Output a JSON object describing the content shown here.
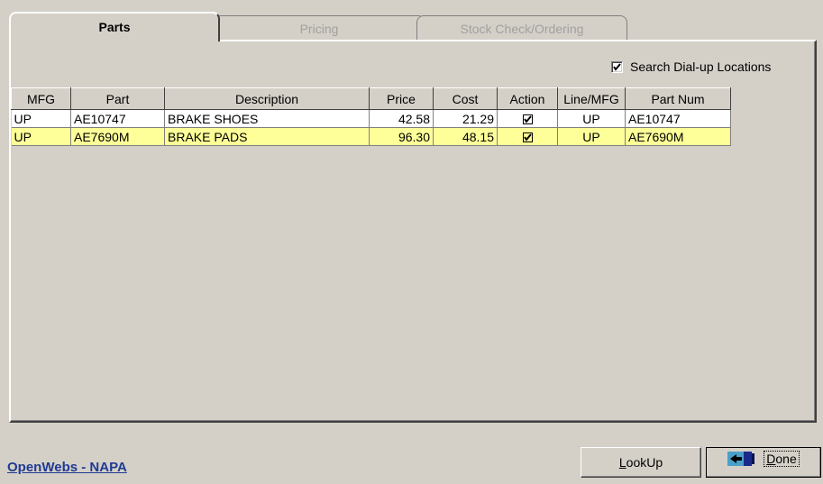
{
  "tabs": {
    "parts": "Parts",
    "pricing": "Pricing",
    "stock": "Stock Check/Ordering"
  },
  "options": {
    "search_dialup_label": "Search Dial-up Locations",
    "search_dialup_checked": true
  },
  "grid": {
    "columns": [
      "MFG",
      "Part",
      "Description",
      "Price",
      "Cost",
      "Action",
      "Line/MFG",
      "Part Num"
    ],
    "rows": [
      {
        "mfg": "UP",
        "part": "AE10747",
        "description": "BRAKE SHOES",
        "price": "42.58",
        "cost": "21.29",
        "action": true,
        "line_mfg": "UP",
        "part_num": "AE10747",
        "highlight": false
      },
      {
        "mfg": "UP",
        "part": "AE7690M",
        "description": "BRAKE PADS",
        "price": "96.30",
        "cost": "48.15",
        "action": true,
        "line_mfg": "UP",
        "part_num": "AE7690M",
        "highlight": true
      }
    ]
  },
  "footer": {
    "link_text": "OpenWebs - NAPA",
    "lookup_label_l": "L",
    "lookup_label_rest": "ookUp",
    "done_label_d": "D",
    "done_label_rest": "one"
  },
  "colors": {
    "highlight_row": "#ffff99",
    "link": "#1f3a93"
  },
  "icons": {
    "done_icon": "exit-door-icon"
  }
}
